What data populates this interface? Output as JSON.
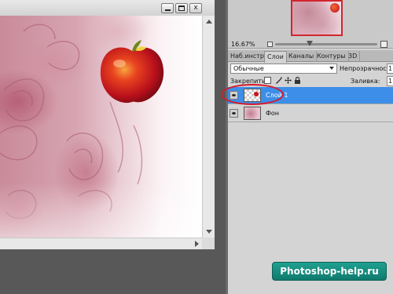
{
  "document": {
    "window_buttons": {
      "minimize": "",
      "maximize": "",
      "close": "x"
    }
  },
  "navigator": {
    "zoom": "16.67%",
    "zoom_level_fraction": 0.34
  },
  "layers_panel": {
    "tabs": [
      {
        "label": "Наб.инстр",
        "active": false
      },
      {
        "label": "Слои",
        "active": true
      },
      {
        "label": "Каналы",
        "active": false
      },
      {
        "label": "Контуры",
        "active": false
      },
      {
        "label": "3D",
        "active": false
      }
    ],
    "blend_mode": "Обычные",
    "opacity_label": "Непрозрачность:",
    "opacity_value": "1",
    "lock_label": "Закрепить:",
    "fill_label": "Заливка:",
    "fill_value": "1",
    "layers": [
      {
        "name": "Слой 1",
        "selected": true,
        "visible": true
      },
      {
        "name": "Фон",
        "selected": false,
        "visible": true
      }
    ]
  },
  "watermark": "Photoshop-help.ru",
  "colors": {
    "selection": "#3d8ee8",
    "highlight_circle": "#d61a2a",
    "watermark_bg": "#139085"
  }
}
